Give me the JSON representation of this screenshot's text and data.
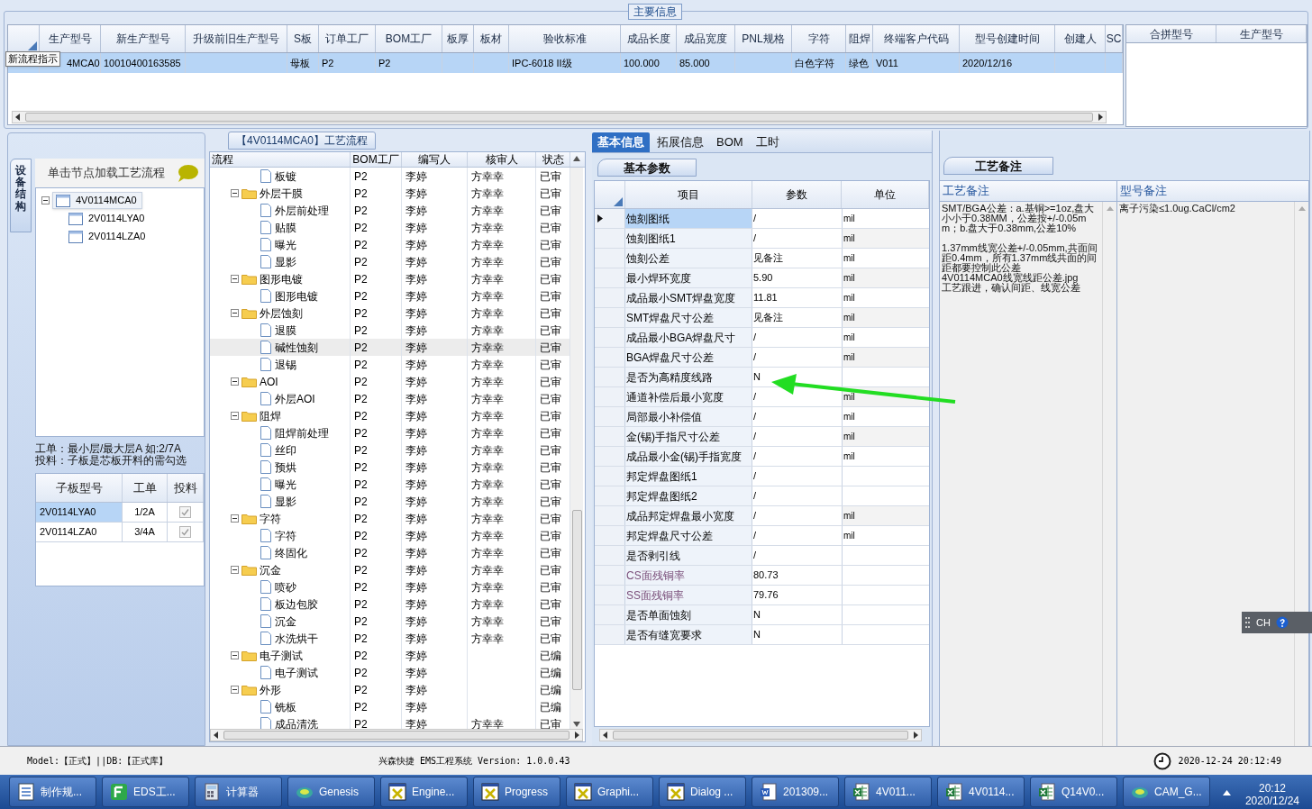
{
  "main_info": {
    "title": "主要信息",
    "tooltip": "新流程指示",
    "columns": [
      "生产型号",
      "新生产型号",
      "升级前旧生产型号",
      "S板",
      "订单工厂",
      "BOM工厂",
      "板厚",
      "板材",
      "验收标准",
      "成品长度",
      "成品宽度",
      "PNL规格",
      "字符",
      "阻焊",
      "终端客户代码",
      "型号创建时间",
      "创建人",
      "SC"
    ],
    "rows": [
      {
        "selected": true,
        "cells": [
          "4MCA0",
          "10010400163585",
          "",
          "母板",
          "P2",
          "P2",
          "",
          "",
          "IPC-6018 II级",
          "100.000",
          "85.000",
          "",
          "白色字符",
          "绿色",
          "V011",
          "2020/12/16",
          "",
          ""
        ]
      }
    ]
  },
  "merge_table": {
    "columns": [
      "合拼型号",
      "生产型号"
    ]
  },
  "structure_panel": {
    "tab": "设备结构",
    "hint": "单击节点加载工艺流程",
    "tree": [
      {
        "label": "4V0114MCA0",
        "expanded": true,
        "selected": true,
        "children": [
          {
            "label": "2V0114LYA0",
            "selected": false
          },
          {
            "label": "2V0114LZA0",
            "selected": false
          }
        ]
      }
    ],
    "notes": [
      "工单：最小层/最大层A 如:2/7A",
      "投料：子板是芯板开料的需勾选"
    ],
    "sub_table": {
      "columns": [
        "子板型号",
        "工单",
        "投料"
      ],
      "rows": [
        {
          "board": "2V0114LYA0",
          "order": "1/2A",
          "feed": true,
          "selected": true
        },
        {
          "board": "2V0114LZA0",
          "order": "3/4A",
          "feed": true,
          "selected": false
        }
      ]
    }
  },
  "process_panel": {
    "title": "【4V0114MCA0】工艺流程",
    "columns": [
      "流程",
      "BOM工厂",
      "编写人",
      "核审人",
      "状态"
    ],
    "rows": [
      {
        "label": "板镀",
        "bom": "P2",
        "writer": "李婷",
        "reviewer": "方幸幸",
        "status": "已审",
        "selected": false
      },
      {
        "label": "外层干膜",
        "bom": "P2",
        "writer": "李婷",
        "reviewer": "方幸幸",
        "status": "已审",
        "selected": false,
        "expanded": true,
        "children": [
          {
            "label": "外层前处理",
            "bom": "P2",
            "writer": "李婷",
            "reviewer": "方幸幸",
            "status": "已审",
            "selected": false
          },
          {
            "label": "贴膜",
            "bom": "P2",
            "writer": "李婷",
            "reviewer": "方幸幸",
            "status": "已审",
            "selected": false
          },
          {
            "label": "曝光",
            "bom": "P2",
            "writer": "李婷",
            "reviewer": "方幸幸",
            "status": "已审",
            "selected": false
          },
          {
            "label": "显影",
            "bom": "P2",
            "writer": "李婷",
            "reviewer": "方幸幸",
            "status": "已审",
            "selected": false
          }
        ]
      },
      {
        "label": "图形电镀",
        "bom": "P2",
        "writer": "李婷",
        "reviewer": "方幸幸",
        "status": "已审",
        "selected": false,
        "expanded": true,
        "children": [
          {
            "label": "图形电镀",
            "bom": "P2",
            "writer": "李婷",
            "reviewer": "方幸幸",
            "status": "已审",
            "selected": false
          }
        ]
      },
      {
        "label": "外层蚀刻",
        "bom": "P2",
        "writer": "李婷",
        "reviewer": "方幸幸",
        "status": "已审",
        "selected": false,
        "expanded": true,
        "children": [
          {
            "label": "退膜",
            "bom": "P2",
            "writer": "李婷",
            "reviewer": "方幸幸",
            "status": "已审",
            "selected": false
          },
          {
            "label": "碱性蚀刻",
            "bom": "P2",
            "writer": "李婷",
            "reviewer": "方幸幸",
            "status": "已审",
            "selected": true
          },
          {
            "label": "退锡",
            "bom": "P2",
            "writer": "李婷",
            "reviewer": "方幸幸",
            "status": "已审",
            "selected": false
          }
        ]
      },
      {
        "label": "AOI",
        "bom": "P2",
        "writer": "李婷",
        "reviewer": "方幸幸",
        "status": "已审",
        "selected": false,
        "expanded": true,
        "children": [
          {
            "label": "外层AOI",
            "bom": "P2",
            "writer": "李婷",
            "reviewer": "方幸幸",
            "status": "已审",
            "selected": false
          }
        ]
      },
      {
        "label": "阻焊",
        "bom": "P2",
        "writer": "李婷",
        "reviewer": "方幸幸",
        "status": "已审",
        "selected": false,
        "expanded": true,
        "children": [
          {
            "label": "阻焊前处理",
            "bom": "P2",
            "writer": "李婷",
            "reviewer": "方幸幸",
            "status": "已审",
            "selected": false
          },
          {
            "label": "丝印",
            "bom": "P2",
            "writer": "李婷",
            "reviewer": "方幸幸",
            "status": "已审",
            "selected": false
          },
          {
            "label": "预烘",
            "bom": "P2",
            "writer": "李婷",
            "reviewer": "方幸幸",
            "status": "已审",
            "selected": false
          },
          {
            "label": "曝光",
            "bom": "P2",
            "writer": "李婷",
            "reviewer": "方幸幸",
            "status": "已审",
            "selected": false
          },
          {
            "label": "显影",
            "bom": "P2",
            "writer": "李婷",
            "reviewer": "方幸幸",
            "status": "已审",
            "selected": false
          }
        ]
      },
      {
        "label": "字符",
        "bom": "P2",
        "writer": "李婷",
        "reviewer": "方幸幸",
        "status": "已审",
        "selected": false,
        "expanded": true,
        "children": [
          {
            "label": "字符",
            "bom": "P2",
            "writer": "李婷",
            "reviewer": "方幸幸",
            "status": "已审",
            "selected": false
          },
          {
            "label": "终固化",
            "bom": "P2",
            "writer": "李婷",
            "reviewer": "方幸幸",
            "status": "已审",
            "selected": false
          }
        ]
      },
      {
        "label": "沉金",
        "bom": "P2",
        "writer": "李婷",
        "reviewer": "方幸幸",
        "status": "已审",
        "selected": false,
        "expanded": true,
        "children": [
          {
            "label": "喷砂",
            "bom": "P2",
            "writer": "李婷",
            "reviewer": "方幸幸",
            "status": "已审",
            "selected": false
          },
          {
            "label": "板边包胶",
            "bom": "P2",
            "writer": "李婷",
            "reviewer": "方幸幸",
            "status": "已审",
            "selected": false
          },
          {
            "label": "沉金",
            "bom": "P2",
            "writer": "李婷",
            "reviewer": "方幸幸",
            "status": "已审",
            "selected": false
          },
          {
            "label": "水洗烘干",
            "bom": "P2",
            "writer": "李婷",
            "reviewer": "方幸幸",
            "status": "已审",
            "selected": false
          }
        ]
      },
      {
        "label": "电子测试",
        "bom": "P2",
        "writer": "李婷",
        "status": "已编",
        "selected": false,
        "expanded": true,
        "children": [
          {
            "label": "电子测试",
            "bom": "P2",
            "writer": "李婷",
            "status": "已编",
            "selected": false
          }
        ]
      },
      {
        "label": "外形",
        "bom": "P2",
        "writer": "李婷",
        "status": "已编",
        "selected": false,
        "expanded": true,
        "children": [
          {
            "label": "铣板",
            "bom": "P2",
            "writer": "李婷",
            "status": "已编",
            "selected": false
          },
          {
            "label": "成品清洗",
            "bom": "P2",
            "writer": "李婷",
            "reviewer": "方幸幸",
            "status": "已审",
            "selected": false
          }
        ]
      }
    ]
  },
  "detail_panel": {
    "tabs": [
      {
        "label": "基本信息",
        "selected": true
      },
      {
        "label": "拓展信息",
        "selected": false
      },
      {
        "label": "BOM",
        "selected": false
      },
      {
        "label": "工时",
        "selected": false
      }
    ],
    "subtab": "基本参数",
    "columns": [
      "项目",
      "参数",
      "单位"
    ],
    "rows": [
      {
        "item": "蚀刻图纸",
        "value": "/",
        "unit": "mil",
        "selected": true
      },
      {
        "item": "蚀刻图纸1",
        "value": "/",
        "unit": "mil",
        "selected": false
      },
      {
        "item": "蚀刻公差",
        "value": "见备注",
        "unit": "mil",
        "selected": false
      },
      {
        "item": "最小焊环宽度",
        "value": "5.90",
        "unit": "mil",
        "selected": false
      },
      {
        "item": "成品最小SMT焊盘宽度",
        "value": "11.81",
        "unit": "mil",
        "selected": false
      },
      {
        "item": "SMT焊盘尺寸公差",
        "value": "见备注",
        "unit": "mil",
        "selected": false
      },
      {
        "item": "成品最小BGA焊盘尺寸",
        "value": "/",
        "unit": "mil",
        "selected": false
      },
      {
        "item": "BGA焊盘尺寸公差",
        "value": "/",
        "unit": "mil",
        "selected": false
      },
      {
        "item": "是否为高精度线路",
        "value": "N",
        "selected": false
      },
      {
        "item": "通道补偿后最小宽度",
        "value": "/",
        "unit": "mil",
        "selected": false
      },
      {
        "item": "局部最小补偿值",
        "value": "/",
        "unit": "mil",
        "selected": false
      },
      {
        "item": "金(锡)手指尺寸公差",
        "value": "/",
        "unit": "mil",
        "selected": false
      },
      {
        "item": "成品最小金(锡)手指宽度",
        "value": "/",
        "unit": "mil",
        "selected": false
      },
      {
        "item": "邦定焊盘图纸1",
        "value": "/",
        "selected": false
      },
      {
        "item": "邦定焊盘图纸2",
        "value": "/",
        "selected": false
      },
      {
        "item": "成品邦定焊盘最小宽度",
        "value": "/",
        "unit": "mil",
        "selected": false
      },
      {
        "item": "邦定焊盘尺寸公差",
        "value": "/",
        "unit": "mil",
        "selected": false
      },
      {
        "item": "是否剥引线",
        "value": "/",
        "selected": false
      },
      {
        "item": "CS面残铜率",
        "value": "80.73",
        "selected": false,
        "color": "#7a4f7a"
      },
      {
        "item": "SS面残铜率",
        "value": "79.76",
        "selected": false,
        "color": "#7a4f7a"
      },
      {
        "item": "是否单面蚀刻",
        "value": "N",
        "selected": false
      },
      {
        "item": "是否有缝宽要求",
        "value": "N",
        "selected": false
      }
    ]
  },
  "notes_panel": {
    "tab": "工艺备注",
    "columns": [
      "工艺备注",
      "型号备注"
    ],
    "process_note": "SMT/BGA公差：a.基铜>=1oz,盘大小小于0.38MM，公差按+/-0.05mm；b.盘大于0.38mm,公差10%\n\n1.37mm线宽公差+/-0.05mm,共面间距0.4mm，所有1.37mm线共面的间距都要控制此公差\n4V0114MCA0线宽线距公差.jpg\n工艺跟进，确认间距、线宽公差",
    "model_note": "离子污染≤1.0ug.CaCl/cm2"
  },
  "ime": {
    "label": "CH"
  },
  "status_bar": {
    "model": "Model:【正式】||DB:【正式库】",
    "app": "兴森快捷 EMS工程系统 Version: 1.0.0.43",
    "datetime": "2020-12-24 20:12:49"
  },
  "taskbar": {
    "items": [
      {
        "label": "制作规...",
        "kind": "list"
      },
      {
        "label": "EDS工...",
        "kind": "app"
      },
      {
        "label": "计算器",
        "kind": "calc"
      },
      {
        "label": "Genesis",
        "kind": "disc"
      },
      {
        "label": "Engine...",
        "kind": "window"
      },
      {
        "label": "Progress",
        "kind": "window"
      },
      {
        "label": "Graphi...",
        "kind": "window"
      },
      {
        "label": "Dialog ...",
        "kind": "window"
      },
      {
        "label": "201309...",
        "kind": "word"
      },
      {
        "label": "4V011...",
        "kind": "sheet"
      },
      {
        "label": "4V0114...",
        "kind": "sheet"
      },
      {
        "label": "Q14V0...",
        "kind": "sheet"
      },
      {
        "label": "CAM_G...",
        "kind": "disc"
      }
    ],
    "time": "20:12",
    "date": "2020/12/24"
  }
}
